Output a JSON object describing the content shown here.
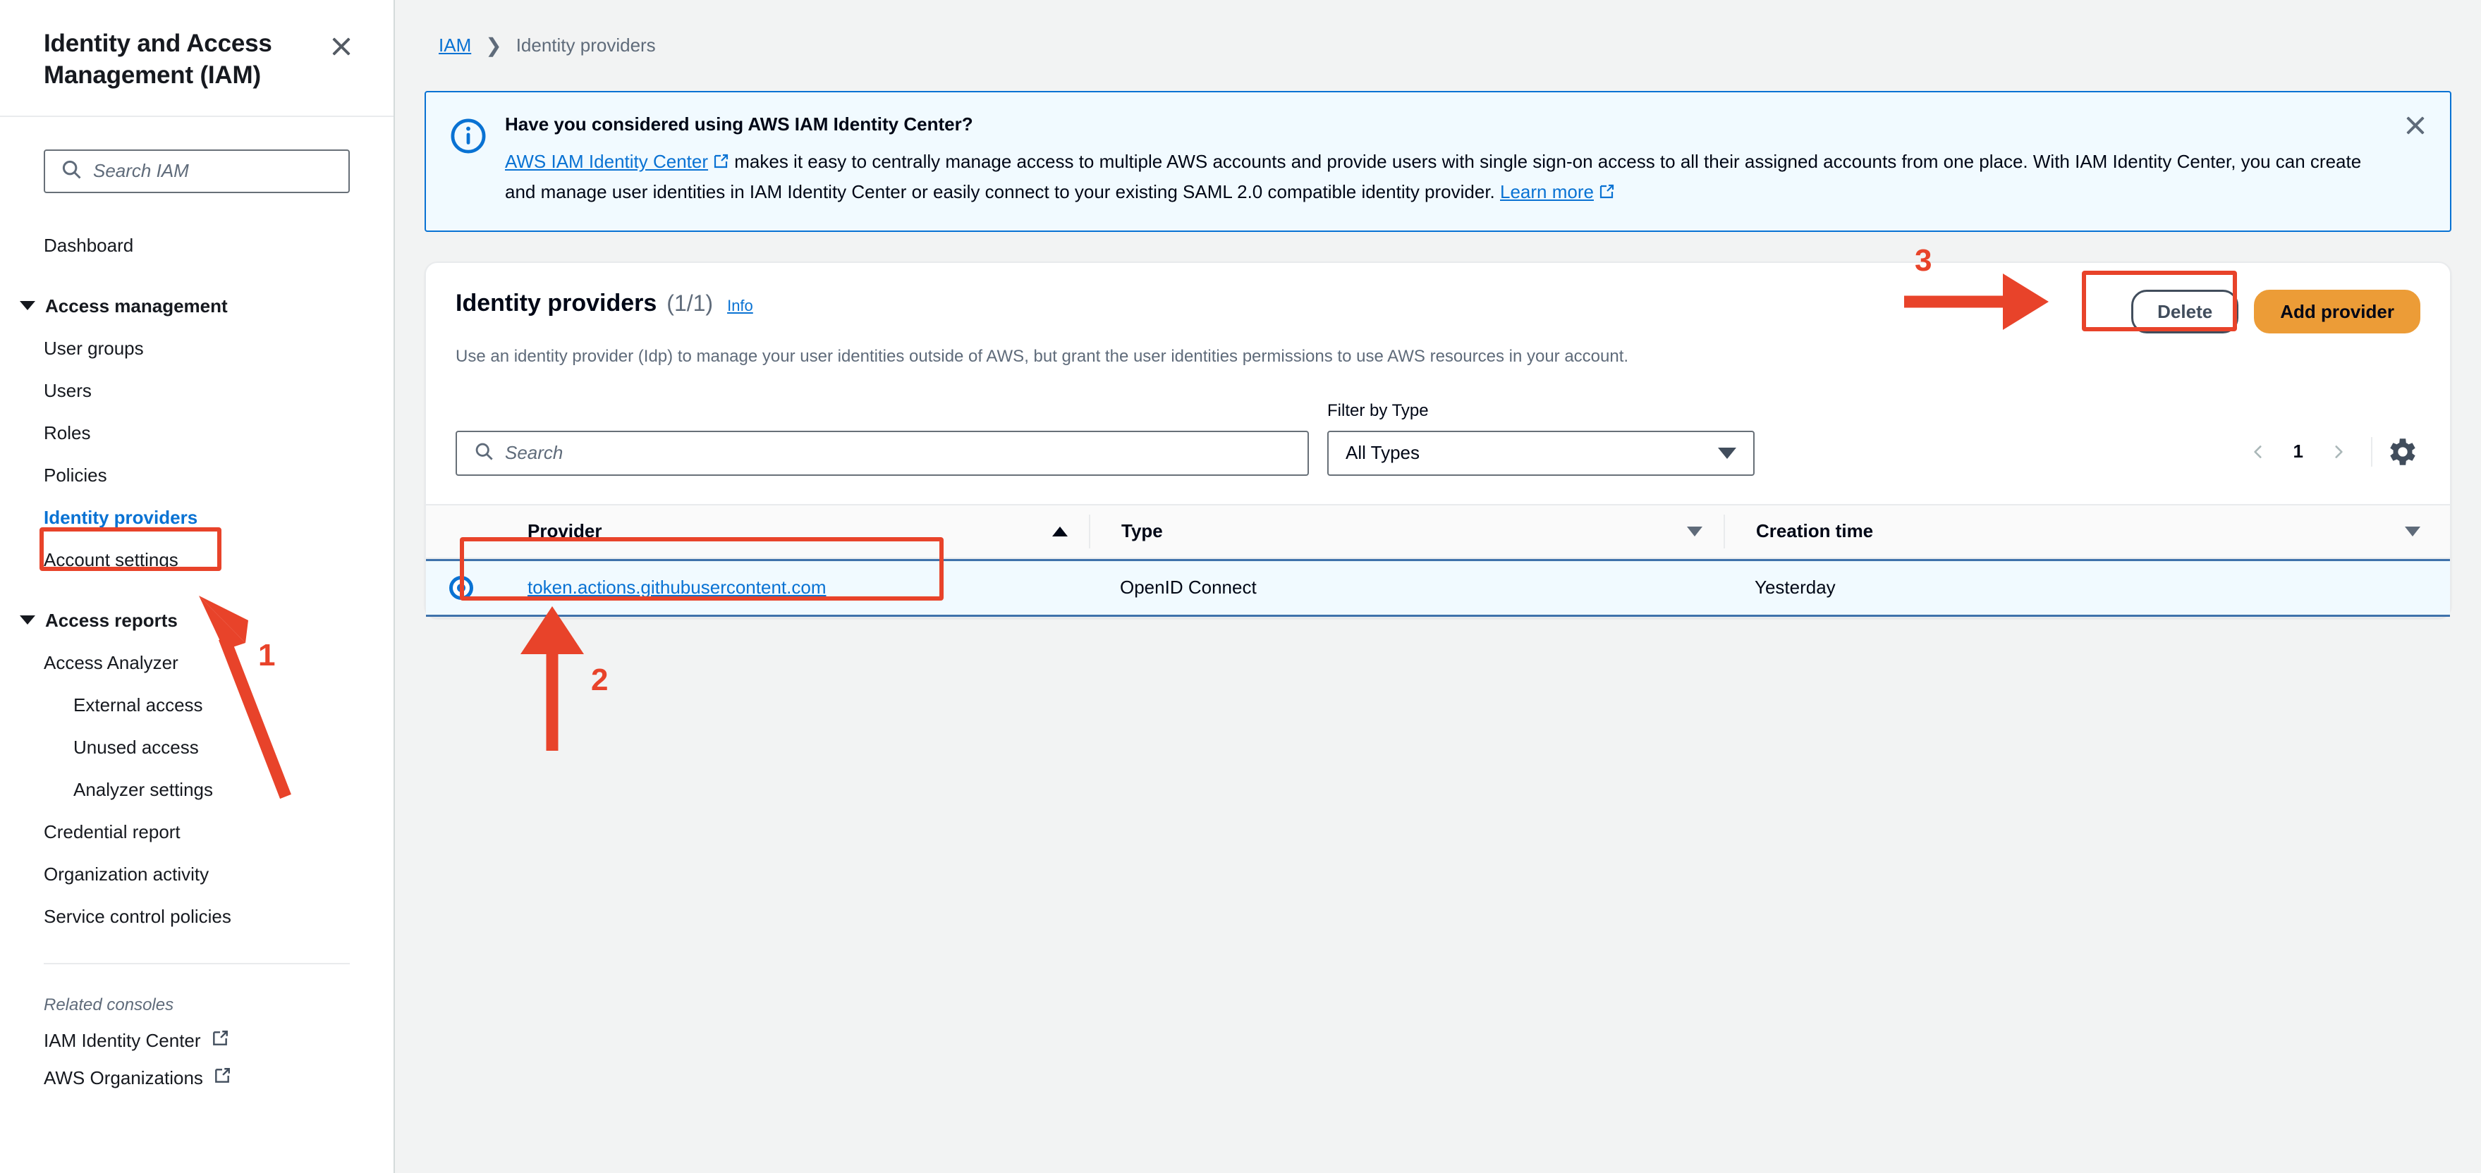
{
  "sidebar": {
    "title": "Identity and Access Management (IAM)",
    "close_label": "Close",
    "search_placeholder": "Search IAM",
    "dashboard": "Dashboard",
    "group_access_management": "Access management",
    "items_access_management": [
      "User groups",
      "Users",
      "Roles",
      "Policies",
      "Identity providers",
      "Account settings"
    ],
    "group_access_reports": "Access reports",
    "access_analyzer": "Access Analyzer",
    "analyzer_subitems": [
      "External access",
      "Unused access",
      "Analyzer settings"
    ],
    "items_access_reports_tail": [
      "Credential report",
      "Organization activity",
      "Service control policies"
    ],
    "related_consoles_label": "Related consoles",
    "related_consoles": [
      "IAM Identity Center",
      "AWS Organizations"
    ]
  },
  "breadcrumb": {
    "root": "IAM",
    "current": "Identity providers"
  },
  "banner": {
    "heading": "Have you considered using AWS IAM Identity Center?",
    "link_text": "AWS IAM Identity Center",
    "body_part1": " makes it easy to centrally manage access to multiple AWS accounts and provide users with single sign-on access to all their assigned accounts from one place. With IAM Identity Center, you can create and manage user identities in IAM Identity Center or easily connect to your existing SAML 2.0 compatible identity provider. ",
    "learn_more": "Learn more"
  },
  "card": {
    "title": "Identity providers",
    "count": "(1/1)",
    "info": "Info",
    "description": "Use an identity provider (Idp) to manage your user identities outside of AWS, but grant the user identities permissions to use AWS resources in your account.",
    "delete_label": "Delete",
    "add_provider_label": "Add provider"
  },
  "toolbar": {
    "search_placeholder": "Search",
    "filter_label": "Filter by Type",
    "filter_value": "All Types",
    "page_number": "1"
  },
  "table": {
    "columns": [
      "Provider",
      "Type",
      "Creation time"
    ],
    "rows": [
      {
        "provider": "token.actions.githubusercontent.com",
        "type": "OpenID Connect",
        "creation_time": "Yesterday",
        "selected": true
      }
    ]
  },
  "annotations": {
    "step1": "1",
    "step2": "2",
    "step3": "3"
  },
  "colors": {
    "accent_blue": "#0972d3",
    "annotation_red": "#e8432a",
    "primary_orange": "#ec9c37",
    "row_selected_bg": "#f1faff"
  }
}
